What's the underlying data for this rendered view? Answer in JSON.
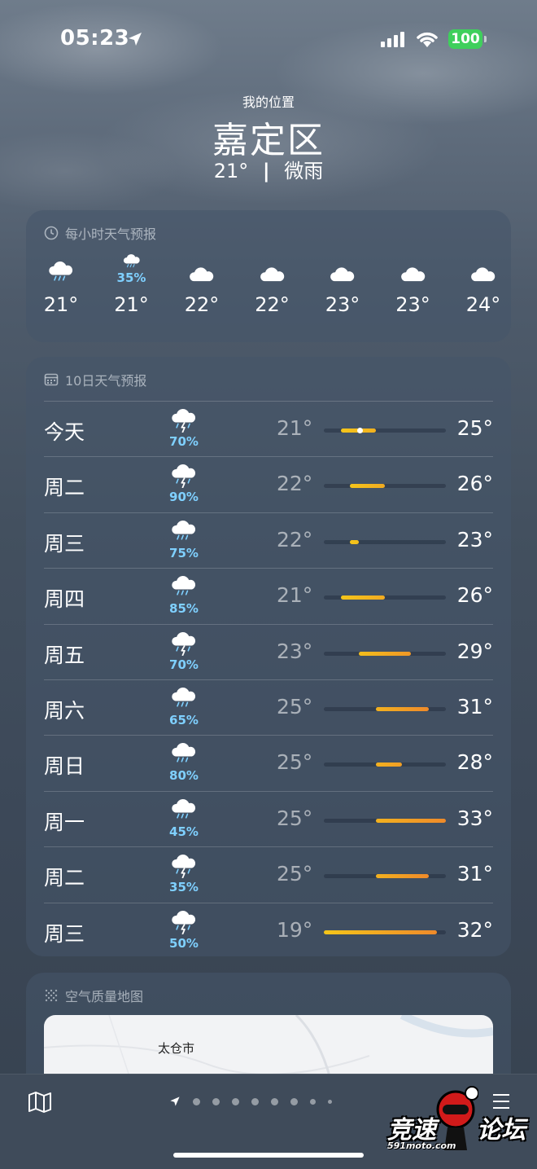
{
  "status_bar": {
    "time": "05:23",
    "battery": "100"
  },
  "header": {
    "my_location": "我的位置",
    "city": "嘉定区",
    "temp": "21°",
    "separator": "|",
    "condition": "微雨"
  },
  "hourly": {
    "title": "每小时天气预报",
    "items": [
      {
        "temp": "21°",
        "pct": "",
        "icon": "cloud-rain-icon"
      },
      {
        "temp": "21°",
        "pct": "35%",
        "icon": "cloud-rain-icon"
      },
      {
        "temp": "22°",
        "pct": "",
        "icon": "cloud-icon"
      },
      {
        "temp": "22°",
        "pct": "",
        "icon": "cloud-icon"
      },
      {
        "temp": "23°",
        "pct": "",
        "icon": "cloud-icon"
      },
      {
        "temp": "23°",
        "pct": "",
        "icon": "cloud-icon"
      },
      {
        "temp": "24°",
        "pct": "",
        "icon": "cloud-icon"
      }
    ]
  },
  "daily": {
    "title": "10日天气预报",
    "range_min": 19,
    "range_max": 33,
    "current_temp": 21,
    "days": [
      {
        "day": "今天",
        "pct": "70%",
        "low": "21°",
        "high": "25°",
        "lo_val": 21,
        "hi_val": 25,
        "icon": "thunderstorm-icon"
      },
      {
        "day": "周二",
        "pct": "90%",
        "low": "22°",
        "high": "26°",
        "lo_val": 22,
        "hi_val": 26,
        "icon": "thunderstorm-icon"
      },
      {
        "day": "周三",
        "pct": "75%",
        "low": "22°",
        "high": "23°",
        "lo_val": 22,
        "hi_val": 23,
        "icon": "cloud-rain-icon"
      },
      {
        "day": "周四",
        "pct": "85%",
        "low": "21°",
        "high": "26°",
        "lo_val": 21,
        "hi_val": 26,
        "icon": "cloud-rain-icon"
      },
      {
        "day": "周五",
        "pct": "70%",
        "low": "23°",
        "high": "29°",
        "lo_val": 23,
        "hi_val": 29,
        "icon": "thunderstorm-icon"
      },
      {
        "day": "周六",
        "pct": "65%",
        "low": "25°",
        "high": "31°",
        "lo_val": 25,
        "hi_val": 31,
        "icon": "cloud-rain-icon"
      },
      {
        "day": "周日",
        "pct": "80%",
        "low": "25°",
        "high": "28°",
        "lo_val": 25,
        "hi_val": 28,
        "icon": "cloud-rain-icon"
      },
      {
        "day": "周一",
        "pct": "45%",
        "low": "25°",
        "high": "33°",
        "lo_val": 25,
        "hi_val": 33,
        "icon": "cloud-rain-icon"
      },
      {
        "day": "周二",
        "pct": "35%",
        "low": "25°",
        "high": "31°",
        "lo_val": 25,
        "hi_val": 31,
        "icon": "thunderstorm-icon"
      },
      {
        "day": "周三",
        "pct": "50%",
        "low": "19°",
        "high": "32°",
        "lo_val": 19,
        "hi_val": 32,
        "icon": "thunderstorm-icon"
      }
    ]
  },
  "air_quality": {
    "title": "空气质量地图",
    "map_label": "太仓市"
  },
  "page_indicator": {
    "count": 9,
    "active": 0
  },
  "watermark": {
    "text_left": "竞速",
    "text_right": "论坛",
    "url": "591moto.com"
  },
  "colors": {
    "cool": "#f4c51a",
    "warm": "#ef8a2a",
    "rain_pct": "#7fd0ff"
  }
}
